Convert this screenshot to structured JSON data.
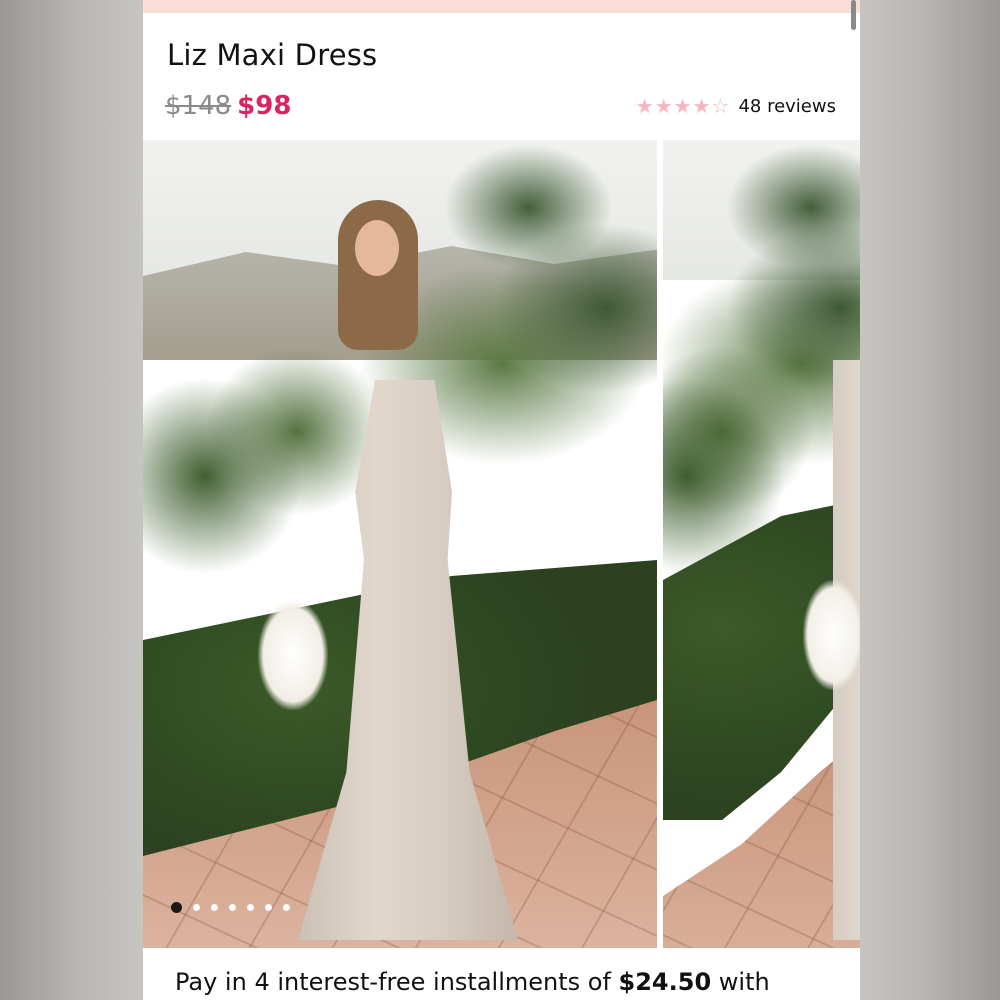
{
  "product": {
    "title": "Liz Maxi Dress",
    "original_price": "$148",
    "sale_price": "$98",
    "rating": 4,
    "rating_max": 5,
    "reviews_label": "48 reviews"
  },
  "gallery": {
    "image_count": 7,
    "active_index": 0
  },
  "installments": {
    "prefix": "Pay in 4 interest-free installments of",
    "amount": "$24.50",
    "suffix": "with"
  },
  "colors": {
    "sale_price": "#d9245f",
    "star": "#f5b6c1",
    "banner": "#f9ddd6"
  }
}
